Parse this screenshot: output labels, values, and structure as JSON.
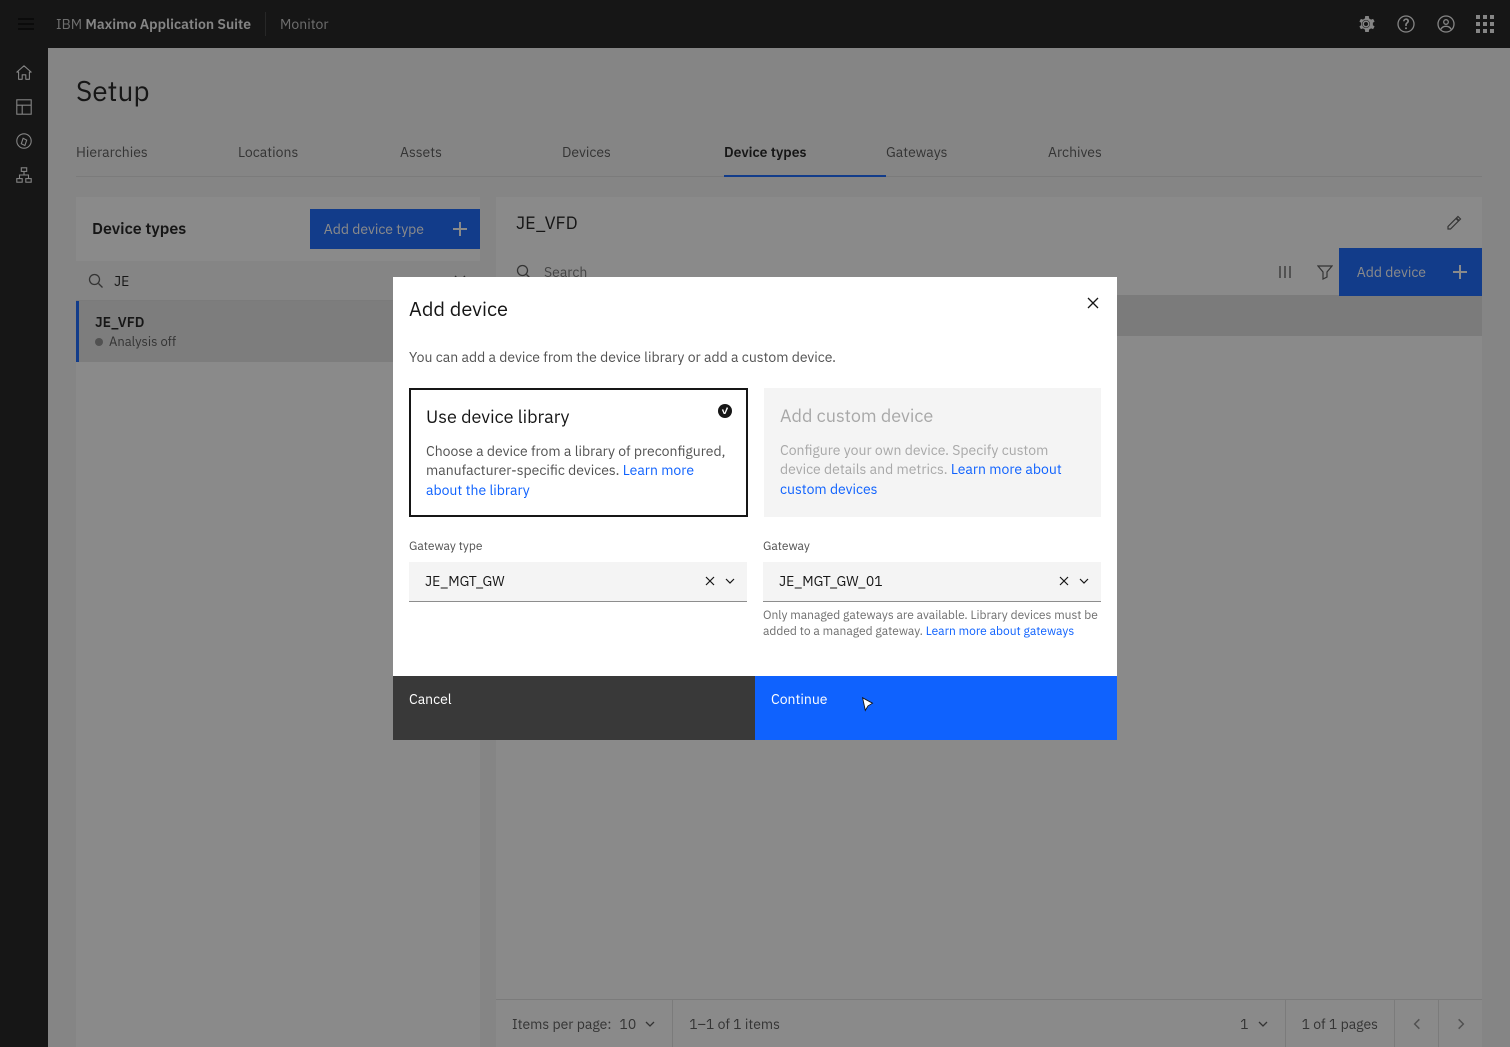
{
  "header": {
    "brand_light_prefix": "IBM ",
    "brand_bold": "Maximo Application Suite",
    "module": "Monitor"
  },
  "page": {
    "title": "Setup"
  },
  "tabs": [
    "Hierarchies",
    "Locations",
    "Assets",
    "Devices",
    "Device types",
    "Gateways",
    "Archives"
  ],
  "active_tab_index": 4,
  "left_panel": {
    "title": "Device types",
    "add_button": "Add device type",
    "search_value": "JE",
    "item": {
      "name": "JE_VFD",
      "status": "Analysis off"
    }
  },
  "right_panel": {
    "title": "JE_VFD",
    "search_placeholder": "Search",
    "add_device_button": "Add device"
  },
  "pagination": {
    "label": "Items per page:",
    "per_page": "10",
    "range": "1–1 of 1 items",
    "page_num": "1",
    "pages_text": "1 of 1 pages"
  },
  "modal": {
    "title": "Add device",
    "description": "You can add a device from the device library or add a custom device.",
    "card_library": {
      "heading": "Use device library",
      "body_prefix": "Choose a device from a library of preconfigured, manufacturer-specific devices. ",
      "link": "Learn more about the library"
    },
    "card_custom": {
      "heading": "Add custom device",
      "body_prefix": "Configure your own device. Specify custom device details and metrics. ",
      "link": "Learn more about custom devices"
    },
    "gateway_type_label": "Gateway type",
    "gateway_type_value": "JE_MGT_GW",
    "gateway_label": "Gateway",
    "gateway_value": "JE_MGT_GW_01",
    "gateway_helper_prefix": "Only managed gateways are available. Library devices must be added to a managed gateway. ",
    "gateway_helper_link": "Learn more about gateways",
    "cancel": "Cancel",
    "continue": "Continue"
  }
}
